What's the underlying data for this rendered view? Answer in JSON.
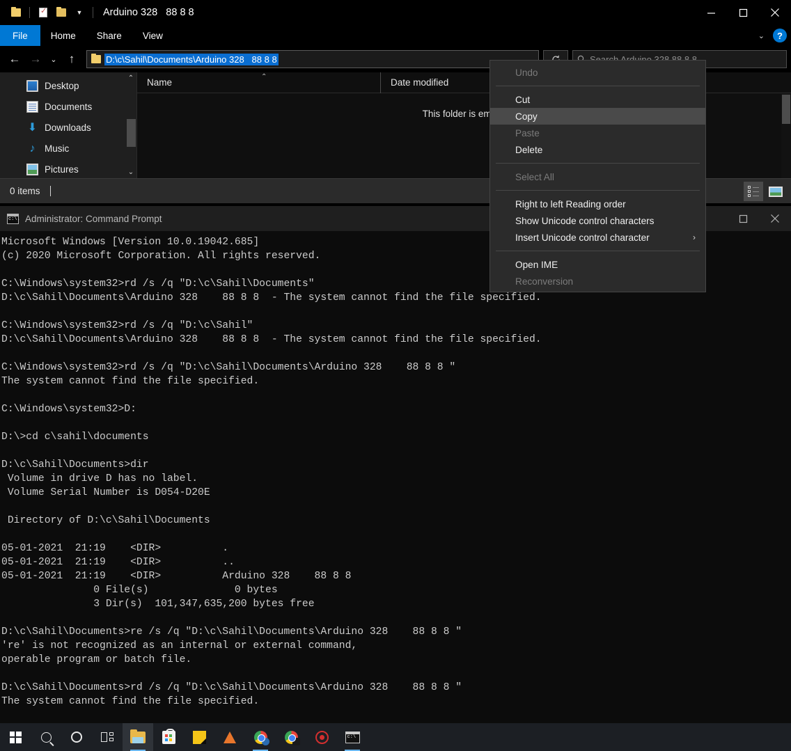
{
  "explorer": {
    "title": "Arduino 328   88 8 8",
    "quick_access": [
      "folder-icon",
      "properties-icon",
      "new-folder-icon",
      "customize-chevron-icon"
    ],
    "window_buttons": {
      "minimize": "minimize-icon",
      "maximize": "maximize-icon",
      "close": "close-icon"
    },
    "ribbon": {
      "tabs": [
        "File",
        "Home",
        "Share",
        "View"
      ],
      "collapse": "chevron-down-icon",
      "help": "?"
    },
    "nav": {
      "back": "back-arrow-icon",
      "forward": "forward-arrow-icon",
      "recent": "chevron-down-icon",
      "up": "up-arrow-icon"
    },
    "address": {
      "value": "D:\\c\\Sahil\\Documents\\Arduino 328   88 8 8",
      "icon": "folder-icon",
      "refresh": "refresh-icon"
    },
    "search": {
      "placeholder": "Search Arduino 328   88 8 8",
      "icon": "search-icon"
    },
    "sidebar": {
      "items": [
        {
          "label": "Desktop",
          "icon": "desktop-icon"
        },
        {
          "label": "Documents",
          "icon": "documents-icon"
        },
        {
          "label": "Downloads",
          "icon": "downloads-icon"
        },
        {
          "label": "Music",
          "icon": "music-icon"
        },
        {
          "label": "Pictures",
          "icon": "pictures-icon"
        }
      ],
      "scroll_up": "chevron-up-icon",
      "scroll_down": "chevron-down-icon"
    },
    "columns": [
      {
        "label": "Name",
        "sorted": true
      },
      {
        "label": "Date modified",
        "sorted": false
      }
    ],
    "empty_message": "This folder is empty.",
    "status": {
      "items_count": "0 items"
    },
    "view_buttons": [
      {
        "name": "details-view",
        "active": true
      },
      {
        "name": "large-icons-view",
        "active": false
      }
    ]
  },
  "context_menu": {
    "groups": [
      [
        {
          "label": "Undo",
          "disabled": true,
          "highlighted": false,
          "submenu": false
        }
      ],
      [
        {
          "label": "Cut",
          "disabled": false,
          "highlighted": false,
          "submenu": false
        },
        {
          "label": "Copy",
          "disabled": false,
          "highlighted": true,
          "submenu": false
        },
        {
          "label": "Paste",
          "disabled": true,
          "highlighted": false,
          "submenu": false
        },
        {
          "label": "Delete",
          "disabled": false,
          "highlighted": false,
          "submenu": false
        }
      ],
      [
        {
          "label": "Select All",
          "disabled": true,
          "highlighted": false,
          "submenu": false
        }
      ],
      [
        {
          "label": "Right to left Reading order",
          "disabled": false,
          "highlighted": false,
          "submenu": false
        },
        {
          "label": "Show Unicode control characters",
          "disabled": false,
          "highlighted": false,
          "submenu": false
        },
        {
          "label": "Insert Unicode control character",
          "disabled": false,
          "highlighted": false,
          "submenu": true
        }
      ],
      [
        {
          "label": "Open IME",
          "disabled": false,
          "highlighted": false,
          "submenu": false
        },
        {
          "label": "Reconversion",
          "disabled": true,
          "highlighted": false,
          "submenu": false
        }
      ]
    ],
    "submenu_arrow": "chevron-right-icon"
  },
  "cmd": {
    "title": "Administrator: Command Prompt",
    "icon": "command-prompt-icon",
    "window_buttons": {
      "maximize": "maximize-icon",
      "close": "close-icon"
    },
    "output": "Microsoft Windows [Version 10.0.19042.685]\n(c) 2020 Microsoft Corporation. All rights reserved.\n\nC:\\Windows\\system32>rd /s /q \"D:\\c\\Sahil\\Documents\"\nD:\\c\\Sahil\\Documents\\Arduino 328    88 8 8  - The system cannot find the file specified.\n\nC:\\Windows\\system32>rd /s /q \"D:\\c\\Sahil\"\nD:\\c\\Sahil\\Documents\\Arduino 328    88 8 8  - The system cannot find the file specified.\n\nC:\\Windows\\system32>rd /s /q \"D:\\c\\Sahil\\Documents\\Arduino 328    88 8 8 \"\nThe system cannot find the file specified.\n\nC:\\Windows\\system32>D:\n\nD:\\>cd c\\sahil\\documents\n\nD:\\c\\Sahil\\Documents>dir\n Volume in drive D has no label.\n Volume Serial Number is D054-D20E\n\n Directory of D:\\c\\Sahil\\Documents\n\n05-01-2021  21:19    <DIR>          .\n05-01-2021  21:19    <DIR>          ..\n05-01-2021  21:19    <DIR>          Arduino 328    88 8 8\n               0 File(s)              0 bytes\n               3 Dir(s)  101,347,635,200 bytes free\n\nD:\\c\\Sahil\\Documents>re /s /q \"D:\\c\\Sahil\\Documents\\Arduino 328    88 8 8 \"\n're' is not recognized as an internal or external command,\noperable program or batch file.\n\nD:\\c\\Sahil\\Documents>rd /s /q \"D:\\c\\Sahil\\Documents\\Arduino 328    88 8 8 \"\nThe system cannot find the file specified."
  },
  "taskbar": {
    "items": [
      {
        "name": "start-button",
        "icon": "windows-logo-icon",
        "active": false,
        "running": false
      },
      {
        "name": "search-button",
        "icon": "search-icon",
        "active": false,
        "running": false
      },
      {
        "name": "cortana-button",
        "icon": "cortana-circle-icon",
        "active": false,
        "running": false
      },
      {
        "name": "task-view-button",
        "icon": "task-view-icon",
        "active": false,
        "running": false
      },
      {
        "name": "file-explorer-button",
        "icon": "folder-icon",
        "active": true,
        "running": true
      },
      {
        "name": "microsoft-store-button",
        "icon": "store-icon",
        "active": false,
        "running": false
      },
      {
        "name": "sticky-notes-button",
        "icon": "sticky-note-icon",
        "active": false,
        "running": false
      },
      {
        "name": "vlc-button",
        "icon": "traffic-cone-icon",
        "active": false,
        "running": false
      },
      {
        "name": "chrome-button",
        "icon": "chrome-icon",
        "active": false,
        "running": true
      },
      {
        "name": "chrome-2-button",
        "icon": "chrome-icon",
        "active": false,
        "running": false
      },
      {
        "name": "antivirus-button",
        "icon": "shield-circle-icon",
        "active": false,
        "running": false
      },
      {
        "name": "command-prompt-button",
        "icon": "command-prompt-icon",
        "active": false,
        "running": true
      }
    ]
  },
  "colors": {
    "accent": "#0078d4",
    "selection": "#0a6ed1",
    "menu_bg": "#2b2b2b",
    "menu_highlight": "#4a4a4a",
    "console_bg": "#0c0c0c",
    "console_fg": "#cccccc",
    "taskbar_bg": "#1c1f24"
  }
}
